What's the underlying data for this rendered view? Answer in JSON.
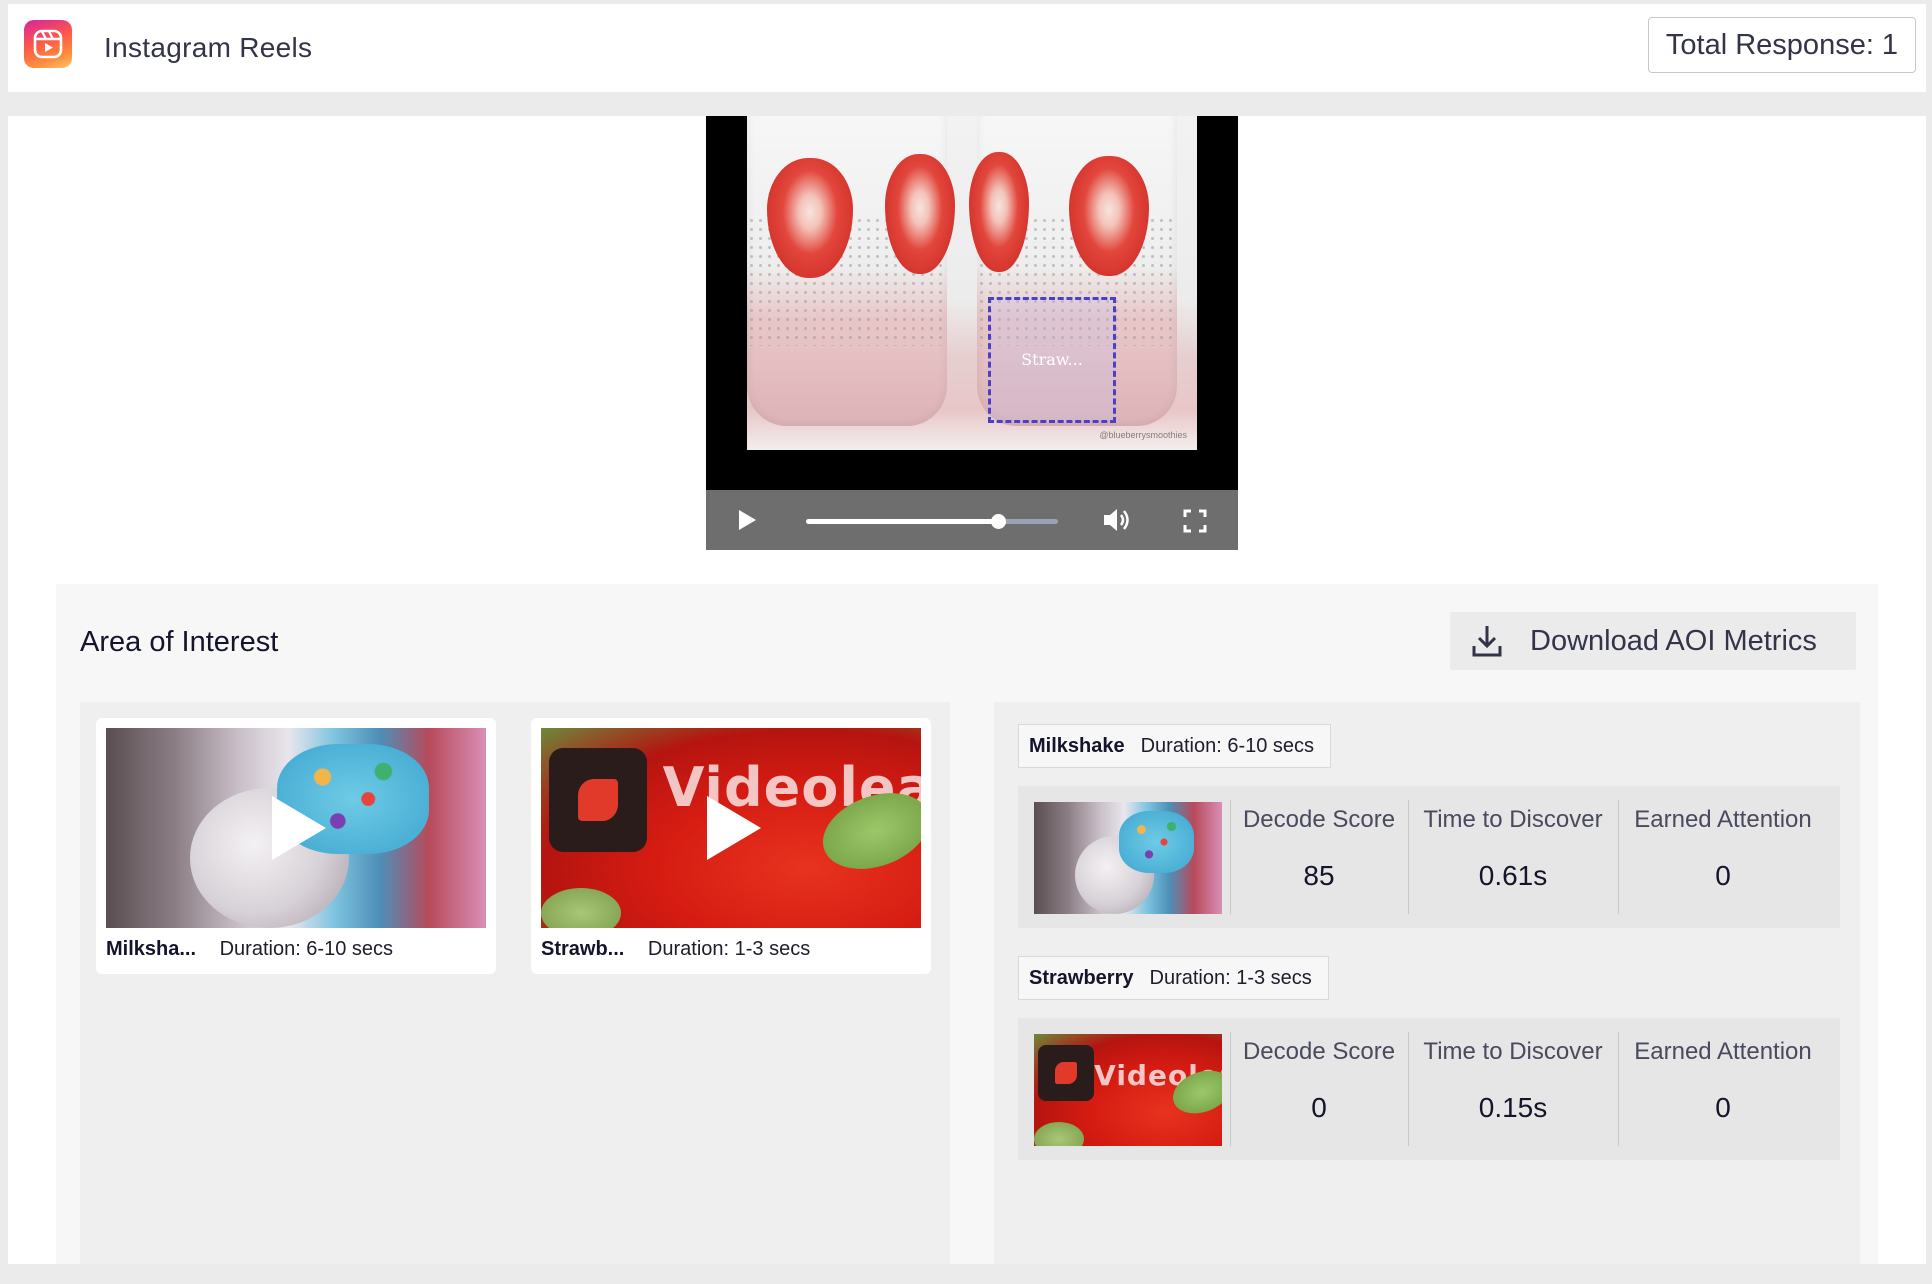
{
  "header": {
    "app_title": "Instagram Reels",
    "total_response": "Total Response: 1"
  },
  "player": {
    "aoi_label": "Straw...",
    "watermark": "@blueberrysmoothies",
    "progress": 0.76
  },
  "aoi": {
    "title": "Area of Interest",
    "download_label": "Download AOI Metrics",
    "cards": [
      {
        "name": "Milksha...",
        "duration": "Duration: 6-10 secs"
      },
      {
        "name": "Strawb...",
        "duration": "Duration: 1-3 secs"
      }
    ],
    "metrics": [
      {
        "name": "Milkshake",
        "duration": "Duration: 6-10 secs",
        "decode_label": "Decode Score",
        "decode_value": "85",
        "time_label": "Time to Discover",
        "time_value": "0.61s",
        "earned_label": "Earned Attention",
        "earned_value": "0"
      },
      {
        "name": "Strawberry",
        "duration": "Duration: 1-3 secs",
        "decode_label": "Decode Score",
        "decode_value": "0",
        "time_label": "Time to Discover",
        "time_value": "0.15s",
        "earned_label": "Earned Attention",
        "earned_value": "0"
      }
    ],
    "thumb_text": "Videoleap"
  },
  "icons": {
    "logo": "instagram-reels-icon",
    "play": "play-icon",
    "volume": "volume-icon",
    "fullscreen": "fullscreen-icon",
    "download": "download-icon"
  },
  "colors": {
    "aoi_box": "#4c3fc8",
    "panel_bg": "#efefef"
  }
}
